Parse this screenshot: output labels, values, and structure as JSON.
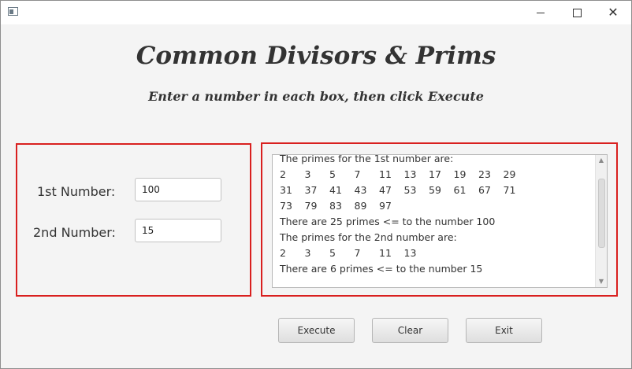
{
  "window": {
    "minimize_icon": "minimize-icon",
    "maximize_icon": "maximize-icon",
    "close_glyph": "✕"
  },
  "header": {
    "title": "Common Divisors & Prims",
    "subtitle": "Enter a number in each box, then click Execute"
  },
  "inputs": {
    "first_label": "1st Number:",
    "first_value": "100",
    "second_label": "2nd Number:",
    "second_value": "15"
  },
  "output": {
    "line1": "The primes for the 1st number are:",
    "primes_first_row1": [
      "2",
      "3",
      "5",
      "7",
      "11",
      "13",
      "17",
      "19",
      "23",
      "29"
    ],
    "primes_first_row2": [
      "31",
      "37",
      "41",
      "43",
      "47",
      "53",
      "59",
      "61",
      "67",
      "71"
    ],
    "primes_first_row3": [
      "73",
      "79",
      "83",
      "89",
      "97"
    ],
    "count_first": "There are 25 primes <= to the number 100",
    "line2": "The primes for the 2nd number are:",
    "primes_second_row1": [
      "2",
      "3",
      "5",
      "7",
      "11",
      "13"
    ],
    "count_second": "There are 6 primes <= to the number 15"
  },
  "buttons": {
    "execute": "Execute",
    "clear": "Clear",
    "exit": "Exit"
  },
  "colors": {
    "panel_border": "#d9201f",
    "background": "#f4f4f4"
  }
}
